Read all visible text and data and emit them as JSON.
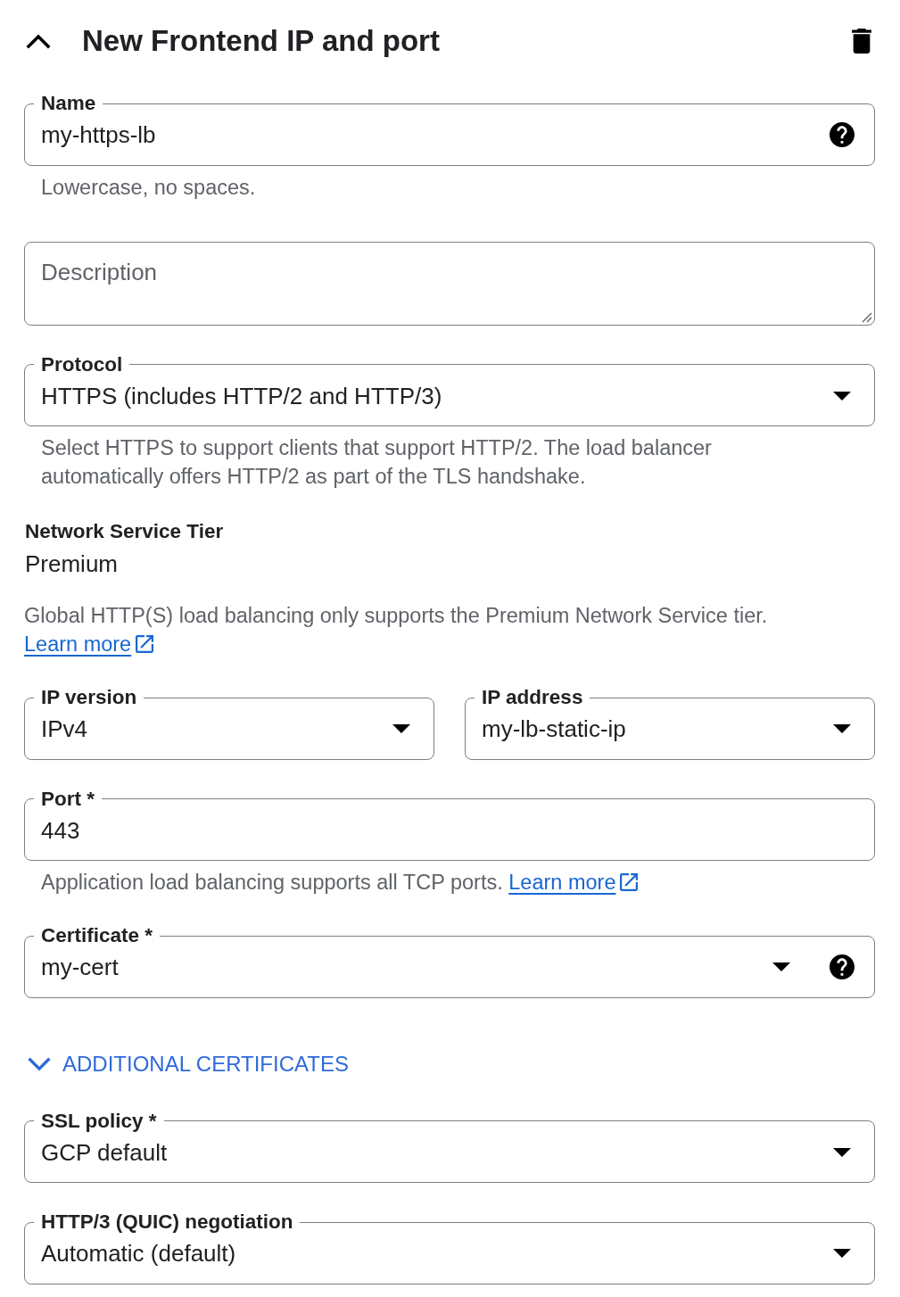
{
  "header": {
    "title": "New Frontend IP and port",
    "expanded": true
  },
  "items": [
    {
      "kind": "text",
      "label": "Name",
      "value": "my-https-lb",
      "help": true,
      "hint": {
        "text": "Lowercase, no spaces."
      }
    },
    {
      "kind": "textarea",
      "placeholder": "Description"
    },
    {
      "kind": "select",
      "label": "Protocol",
      "value": "HTTPS (includes HTTP/2 and HTTP/3)",
      "hint": {
        "text": "Select HTTPS to support clients that support HTTP/2. The load balancer automatically offers HTTP/2 as part of the TLS handshake."
      }
    },
    {
      "kind": "info",
      "label": "Network Service Tier",
      "value": "Premium",
      "note": {
        "text": "Global HTTP(S) load balancing only supports the Premium Network Service tier.",
        "link": "Learn more"
      }
    },
    {
      "kind": "row",
      "fields": [
        {
          "kind": "select",
          "label": "IP version",
          "value": "IPv4"
        },
        {
          "kind": "select",
          "label": "IP address",
          "value": "my-lb-static-ip"
        }
      ]
    },
    {
      "kind": "text",
      "label": "Port *",
      "value": "443",
      "hint": {
        "text": "Application load balancing supports all TCP ports.",
        "link": "Learn more"
      }
    },
    {
      "kind": "select",
      "label": "Certificate *",
      "value": "my-cert",
      "help": true
    },
    {
      "kind": "expander",
      "label": "ADDITIONAL CERTIFICATES",
      "expanded": false
    },
    {
      "kind": "select",
      "label": "SSL policy *",
      "value": "GCP default"
    },
    {
      "kind": "select",
      "label": "HTTP/3 (QUIC) negotiation",
      "value": "Automatic (default)"
    }
  ]
}
